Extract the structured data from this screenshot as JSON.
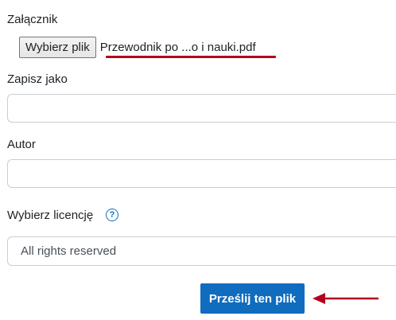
{
  "form": {
    "attachment_label": "Załącznik",
    "choose_file_label": "Wybierz plik",
    "selected_file_name": "Przewodnik po ...o i nauki.pdf",
    "save_as_label": "Zapisz jako",
    "save_as_value": "",
    "author_label": "Autor",
    "author_value": "",
    "license_label": "Wybierz licencję",
    "license_help_glyph": "?",
    "license_selected": "All rights reserved",
    "submit_label": "Prześlij ten plik"
  },
  "colors": {
    "primary": "#0f6cbf",
    "annotation_red": "#b3001f"
  },
  "icons": {
    "help": "question-circle-icon",
    "annotation_arrow": "arrow-left-icon"
  }
}
